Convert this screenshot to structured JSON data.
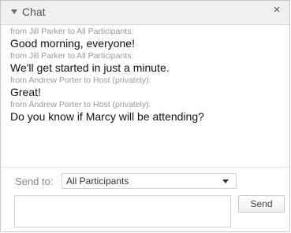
{
  "header": {
    "title": "Chat",
    "close_glyph": "×",
    "caret_icon": "caret-down-icon",
    "close_icon": "close-icon"
  },
  "messages": [
    {
      "from": "from Jill Parker to All Participants:",
      "text": "Good morning, everyone!"
    },
    {
      "from": "from Jill Parker to All Participants:",
      "text": "We'll get started in just a minute."
    },
    {
      "from": "from Andrew Porter to Host (privately):",
      "text": "Great!"
    },
    {
      "from": "from Andrew Porter to Host (privately):",
      "text": "Do you know if Marcy will be attending?"
    }
  ],
  "composer": {
    "send_to_label": "Send to:",
    "recipient_selected": "All Participants",
    "message_value": "",
    "send_label": "Send"
  }
}
